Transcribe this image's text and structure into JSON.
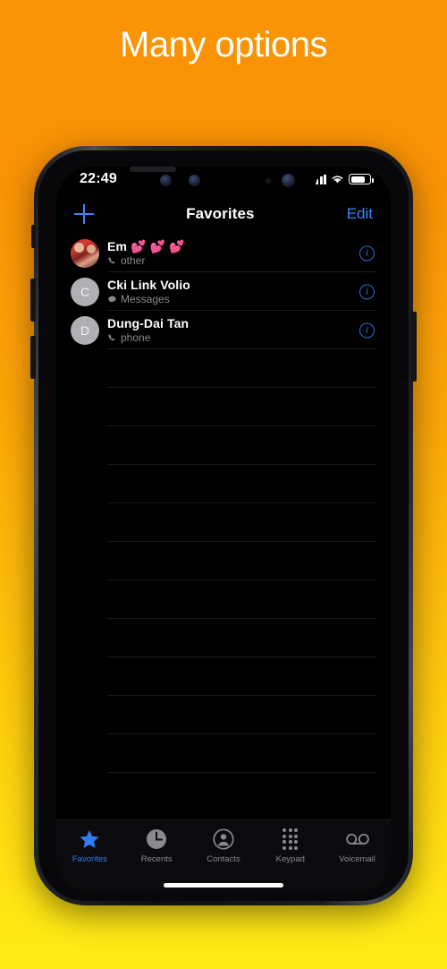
{
  "caption": {
    "text": "Many options"
  },
  "colors": {
    "accent_blue": "#3B88FA",
    "tab_active": "#2F7CF6",
    "subtitle_gray": "#8A8A8E",
    "screen_black": "#000000",
    "bg_orange": "#F89406",
    "bg_yellow": "#FFEC16"
  },
  "status_bar": {
    "time": "22:49",
    "signal_icon": "cellular-bars-icon",
    "signal_bars": 4,
    "wifi_icon": "wifi-icon",
    "battery_icon": "battery-icon",
    "battery_percent": 70
  },
  "nav_bar": {
    "add_icon": "plus-icon",
    "title": "Favorites",
    "edit_label": "Edit"
  },
  "favorites": [
    {
      "name": "Em 💕 💕 💕",
      "subtitle": "other",
      "subtitle_icon": "phone-handset-icon",
      "avatar_type": "photo",
      "avatar_initial": "",
      "info_icon": "info-circle-icon"
    },
    {
      "name": "Cki Link Volio",
      "subtitle": "Messages",
      "subtitle_icon": "message-bubble-icon",
      "avatar_type": "initial",
      "avatar_initial": "C",
      "info_icon": "info-circle-icon"
    },
    {
      "name": "Dung-Dai Tan",
      "subtitle": "phone",
      "subtitle_icon": "phone-handset-icon",
      "avatar_type": "initial",
      "avatar_initial": "D",
      "info_icon": "info-circle-icon"
    }
  ],
  "empty_row_count": 11,
  "tab_bar": {
    "tabs": [
      {
        "label": "Favorites",
        "icon": "star-icon",
        "active": true
      },
      {
        "label": "Recents",
        "icon": "clock-icon",
        "active": false
      },
      {
        "label": "Contacts",
        "icon": "person-circle-icon",
        "active": false
      },
      {
        "label": "Keypad",
        "icon": "keypad-grid-icon",
        "active": false
      },
      {
        "label": "Voicemail",
        "icon": "voicemail-icon",
        "active": false
      }
    ]
  },
  "device": {
    "notch_icons": [
      "front-camera-icon",
      "ir-camera-icon",
      "earpiece-speaker",
      "proximity-sensor-dot",
      "selfie-camera-icon"
    ],
    "buttons": [
      "mute-switch",
      "volume-up-button",
      "volume-down-button",
      "power-button"
    ],
    "home_indicator": "home-indicator"
  }
}
